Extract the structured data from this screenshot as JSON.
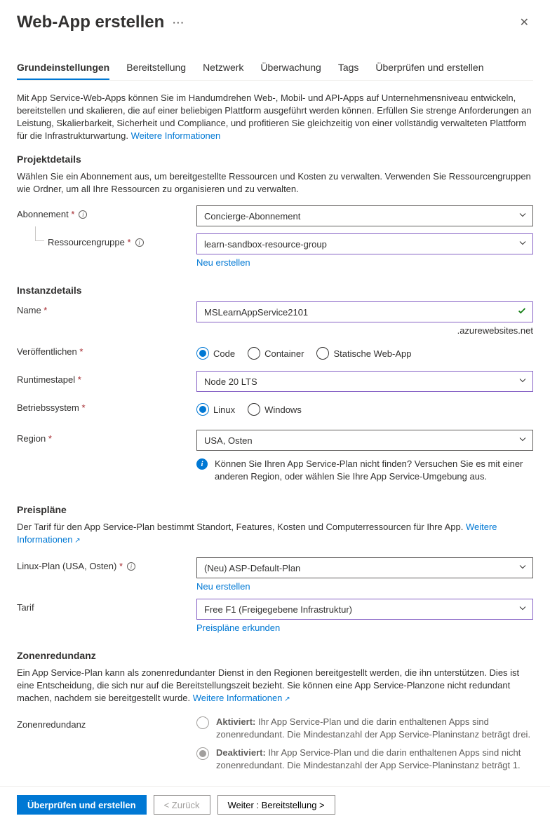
{
  "header": {
    "title": "Web-App erstellen"
  },
  "tabs": [
    {
      "label": "Grundeinstellungen",
      "active": true
    },
    {
      "label": "Bereitstellung"
    },
    {
      "label": "Netzwerk"
    },
    {
      "label": "Überwachung"
    },
    {
      "label": "Tags"
    },
    {
      "label": "Überprüfen und erstellen"
    }
  ],
  "intro": {
    "text": "Mit App Service-Web-Apps können Sie im Handumdrehen Web-, Mobil- und API-Apps auf Unternehmensniveau entwickeln, bereitstellen und skalieren, die auf einer beliebigen Plattform ausgeführt werden können. Erfüllen Sie strenge Anforderungen an Leistung, Skalierbarkeit, Sicherheit und Compliance, und profitieren Sie gleichzeitig von einer vollständig verwalteten Plattform für die Infrastrukturwartung. ",
    "link": "Weitere Informationen"
  },
  "project": {
    "title": "Projektdetails",
    "desc": "Wählen Sie ein Abonnement aus, um bereitgestellte Ressourcen und Kosten zu verwalten. Verwenden Sie Ressourcengruppen wie Ordner, um all Ihre Ressourcen zu organisieren und zu verwalten.",
    "subscription_label": "Abonnement",
    "subscription_value": "Concierge-Abonnement",
    "rg_label": "Ressourcengruppe",
    "rg_value": "learn-sandbox-resource-group",
    "rg_new": "Neu erstellen"
  },
  "instance": {
    "title": "Instanzdetails",
    "name_label": "Name",
    "name_value": "MSLearnAppService2101",
    "name_suffix": ".azurewebsites.net",
    "publish_label": "Veröffentlichen",
    "publish_options": [
      "Code",
      "Container",
      "Statische Web-App"
    ],
    "runtime_label": "Runtimestapel",
    "runtime_value": "Node 20 LTS",
    "os_label": "Betriebssystem",
    "os_options": [
      "Linux",
      "Windows"
    ],
    "region_label": "Region",
    "region_value": "USA, Osten",
    "region_info": "Können Sie Ihren App Service-Plan nicht finden? Versuchen Sie es mit einer anderen Region, oder wählen Sie Ihre App Service-Umgebung aus."
  },
  "pricing": {
    "title": "Preispläne",
    "desc": "Der Tarif für den App Service-Plan bestimmt Standort, Features, Kosten und Computerressourcen für Ihre App. ",
    "link": "Weitere Informationen",
    "plan_label": "Linux-Plan (USA, Osten)",
    "plan_value": "(Neu) ASP-Default-Plan",
    "plan_new": "Neu erstellen",
    "tarif_label": "Tarif",
    "tarif_value": "Free F1 (Freigegebene Infrastruktur)",
    "tarif_link": "Preispläne erkunden"
  },
  "zone": {
    "title": "Zonenredundanz",
    "desc": "Ein App Service-Plan kann als zonenredundanter Dienst in den Regionen bereitgestellt werden, die ihn unterstützen. Dies ist eine Entscheidung, die sich nur auf die Bereitstellungszeit bezieht. Sie können eine App Service-Planzone nicht redundant machen, nachdem sie bereitgestellt wurde. ",
    "link": "Weitere Informationen",
    "label": "Zonenredundanz",
    "opt1_title": "Aktiviert:",
    "opt1_text": " Ihr App Service-Plan und die darin enthaltenen Apps sind zonenredundant. Die Mindestanzahl der App Service-Planinstanz beträgt drei.",
    "opt2_title": "Deaktiviert:",
    "opt2_text": " Ihr App Service-Plan und die darin enthaltenen Apps sind nicht zonenredundant. Die Mindestanzahl der App Service-Planinstanz beträgt 1."
  },
  "footer": {
    "review": "Überprüfen und erstellen",
    "back": "<  Zurück",
    "next": "Weiter : Bereitstellung  >"
  }
}
